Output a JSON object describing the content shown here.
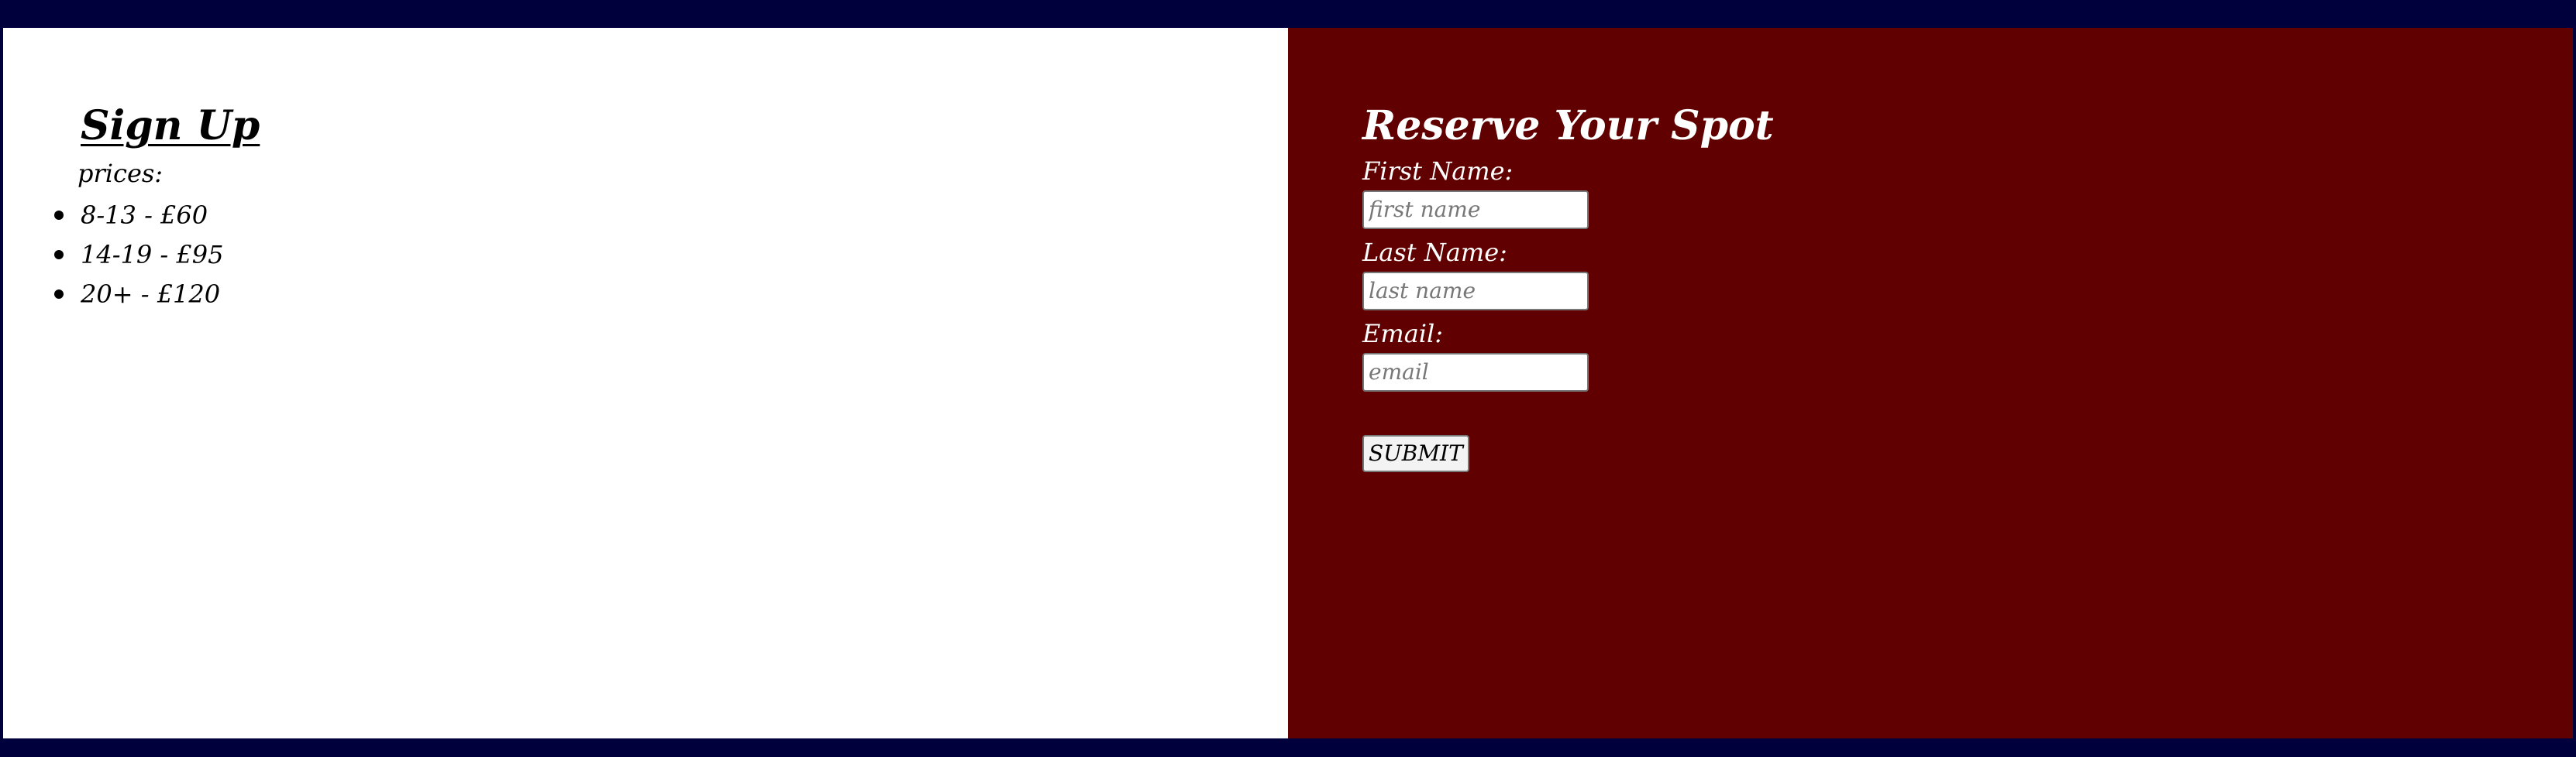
{
  "signup": {
    "title": "Sign Up",
    "prices_label": "prices:",
    "prices": [
      "8-13 - £60",
      "14-19 - £95",
      "20+ - £120"
    ]
  },
  "reservation": {
    "title": "Reserve Your Spot",
    "fields": {
      "first_name": {
        "label": "First Name:",
        "placeholder": "first name",
        "value": ""
      },
      "last_name": {
        "label": "Last Name:",
        "placeholder": "last name",
        "value": ""
      },
      "email": {
        "label": "Email:",
        "placeholder": "email",
        "value": ""
      }
    },
    "submit_label": "SUBMIT"
  },
  "colors": {
    "page_border": "#00003c",
    "left_panel": "#ffffff",
    "right_panel": "#600000",
    "text_dark": "#000000",
    "text_light": "#ffffff"
  }
}
